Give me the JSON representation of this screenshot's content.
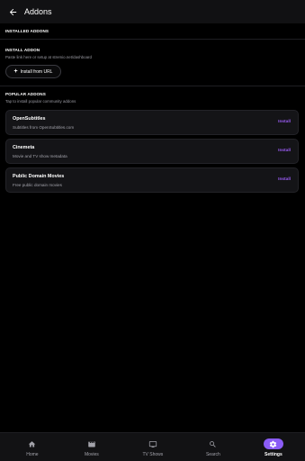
{
  "header": {
    "title": "Addons"
  },
  "installed": {
    "label": "INSTALLED ADDONS"
  },
  "install": {
    "label": "INSTALL ADDON",
    "hint": "Paste link here or setup at stremio.net/dashboard",
    "button_label": "Install from URL"
  },
  "popular": {
    "label": "POPULAR ADDONS",
    "hint": "Tap to install popular community addons",
    "items": [
      {
        "title": "OpenSubtitles",
        "description": "Subtitles from OpenSubtitles.com",
        "action": "Install"
      },
      {
        "title": "Cinemeta",
        "description": "Movie and TV show metadata",
        "action": "Install"
      },
      {
        "title": "Public Domain Movies",
        "description": "Free public domain movies",
        "action": "Install"
      }
    ]
  },
  "nav": {
    "items": [
      {
        "label": "Home",
        "icon": "home-icon"
      },
      {
        "label": "Movies",
        "icon": "film-icon"
      },
      {
        "label": "TV Shows",
        "icon": "tv-icon"
      },
      {
        "label": "Search",
        "icon": "search-icon"
      },
      {
        "label": "Settings",
        "icon": "gear-icon",
        "active": true
      }
    ]
  },
  "colors": {
    "accent": "#8b5cf6",
    "accent_text": "#9b5cf6",
    "background": "#000000",
    "card": "#141417"
  }
}
